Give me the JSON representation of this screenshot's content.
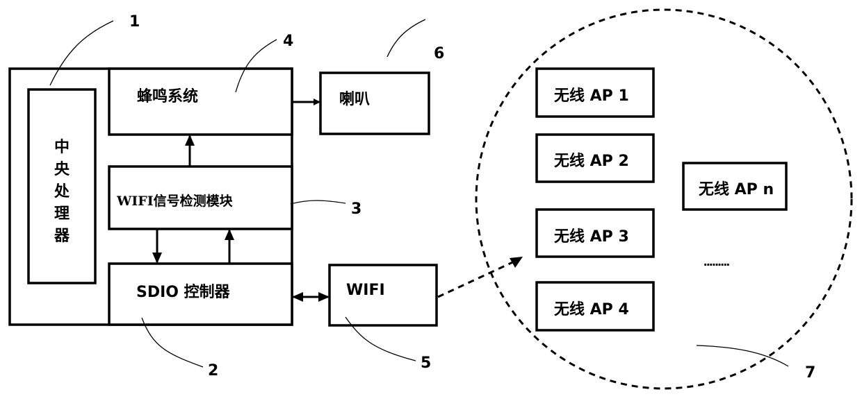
{
  "diagram": {
    "cpu_label_chars": [
      "中",
      "央",
      "处",
      "理",
      "器"
    ],
    "buzzer_system": "蜂鸣系统",
    "wifi_signal_module": "WIFI信号检测模块",
    "sdio_controller": "SDIO 控制器",
    "speaker": "喇叭",
    "wifi": "WIFI",
    "access_points": [
      "无线 AP 1",
      "无线 AP 2",
      "无线 AP 3",
      "无线 AP 4"
    ],
    "access_point_n": "无线 AP n",
    "ellipsis": "·········",
    "callouts": {
      "c1": "1",
      "c2": "2",
      "c3": "3",
      "c4": "4",
      "c5": "5",
      "c6": "6",
      "c7": "7"
    }
  }
}
